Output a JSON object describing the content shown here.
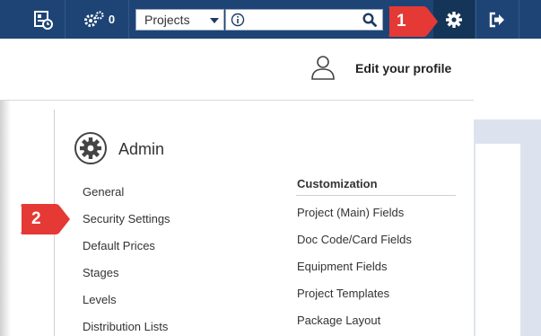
{
  "toolbar": {
    "notifications_count": "0",
    "project_select_value": "Projects",
    "search_value": ""
  },
  "profile": {
    "edit_label": "Edit your profile"
  },
  "admin": {
    "title": "Admin",
    "items": [
      {
        "label": "General"
      },
      {
        "label": "Security Settings"
      },
      {
        "label": "Default Prices"
      },
      {
        "label": "Stages"
      },
      {
        "label": "Levels"
      },
      {
        "label": "Distribution Lists"
      }
    ]
  },
  "customization": {
    "heading": "Customization",
    "items": [
      {
        "label": "Project (Main) Fields"
      },
      {
        "label": "Doc Code/Card Fields"
      },
      {
        "label": "Equipment Fields"
      },
      {
        "label": "Project Templates"
      },
      {
        "label": "Package Layout"
      }
    ]
  },
  "callouts": [
    {
      "label": "1"
    },
    {
      "label": "2"
    }
  ],
  "colors": {
    "topbar": "#1d4475",
    "callout": "#e53935",
    "background_panel": "#dde3ee"
  },
  "icons": [
    "dashboard-icon",
    "workflow-gears-icon",
    "info-icon",
    "search-icon",
    "settings-gear-icon",
    "logout-icon",
    "user-profile-icon",
    "admin-gear-icon"
  ]
}
